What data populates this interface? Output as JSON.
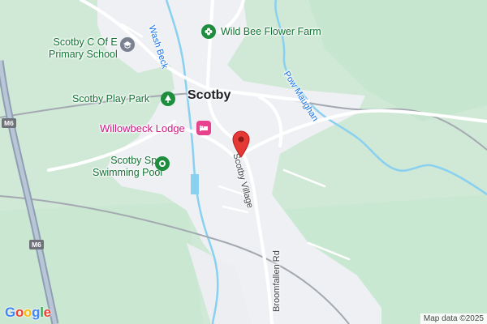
{
  "map": {
    "labels": {
      "school": [
        "Scotby C Of E",
        "Primary School"
      ],
      "wash_beck": "Wash Beck",
      "farm": "Wild Bee Flower Farm",
      "pow_maughan": "Pow Maughan",
      "play_park": "Scotby Play Park",
      "place": "Scotby",
      "lodge": "Willowbeck Lodge",
      "spa": [
        "Scotby Spa",
        "Swimming Pool"
      ],
      "scotby_village": "Scotby Village",
      "broomfallen": "Broomfallen Rd"
    },
    "road_shields": [
      "M6",
      "M6"
    ],
    "attribution": "Map data ©2025",
    "logo": "Google",
    "colors": {
      "land": "#cfe9d6",
      "urban": "#eef0f3",
      "road": "#ffffff",
      "motorway": "#8e9fb5",
      "water": "#8ad0f0",
      "rail": "#a4a9b1",
      "poi_green": "#1e8e3e",
      "hotel": "#e8418e",
      "pin": "#e53935"
    },
    "icons": {
      "school": "school-icon",
      "farm": "flower-icon",
      "park": "tree-icon",
      "hotel": "bed-icon",
      "spa": "pool-icon",
      "pin": "map-pin-icon"
    }
  }
}
